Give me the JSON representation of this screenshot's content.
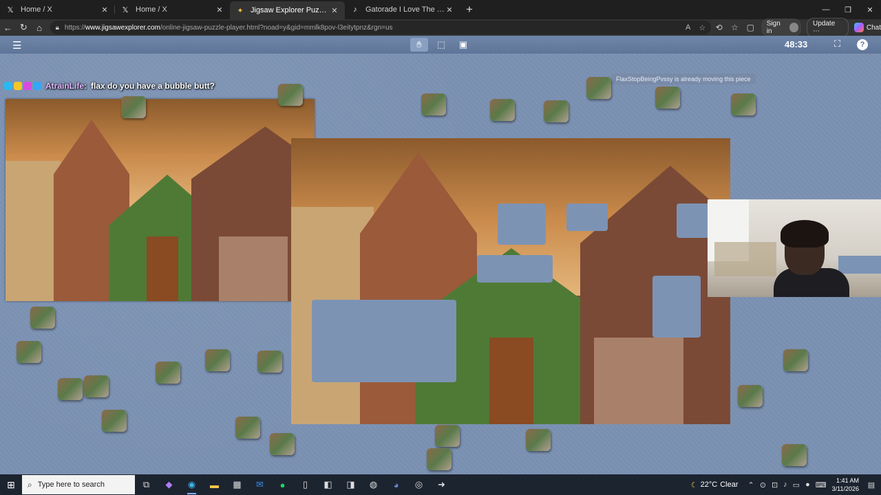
{
  "tabs": [
    {
      "title": "Home / X",
      "icon": "x-logo-icon"
    },
    {
      "title": "Home / X",
      "icon": "x-logo-icon"
    },
    {
      "title": "Jigsaw Explorer Puzzle Player",
      "icon": "puzzle-icon",
      "active": true
    },
    {
      "title": "Gatorade I Love The Way It Tastes",
      "icon": "tiktok-icon"
    }
  ],
  "address": {
    "url_prefix": "https://",
    "url_host": "www.jigsawexplorer.com",
    "url_path": "/online-jigsaw-puzzle-player.html?noad=y&gid=mmlk8pov-l3eitytpnz&rgn=us",
    "sign_in": "Sign in",
    "update": "Update",
    "chat": "Chat"
  },
  "game": {
    "timer": "48:33",
    "chat_user": "AtrainLife:",
    "chat_message": "flax do you have a bubble butt?",
    "tooltip": "FlaxStopBeingPvssy is already moving this piece"
  },
  "taskbar": {
    "search_placeholder": "Type here to search",
    "temperature": "22°C",
    "weather": "Clear",
    "time": "1:41 AM",
    "date": "3/11/2026"
  },
  "colors": {
    "board": "#7d93b4",
    "toolbar": "#5e7598",
    "chat_user": "#e2b7ff"
  }
}
